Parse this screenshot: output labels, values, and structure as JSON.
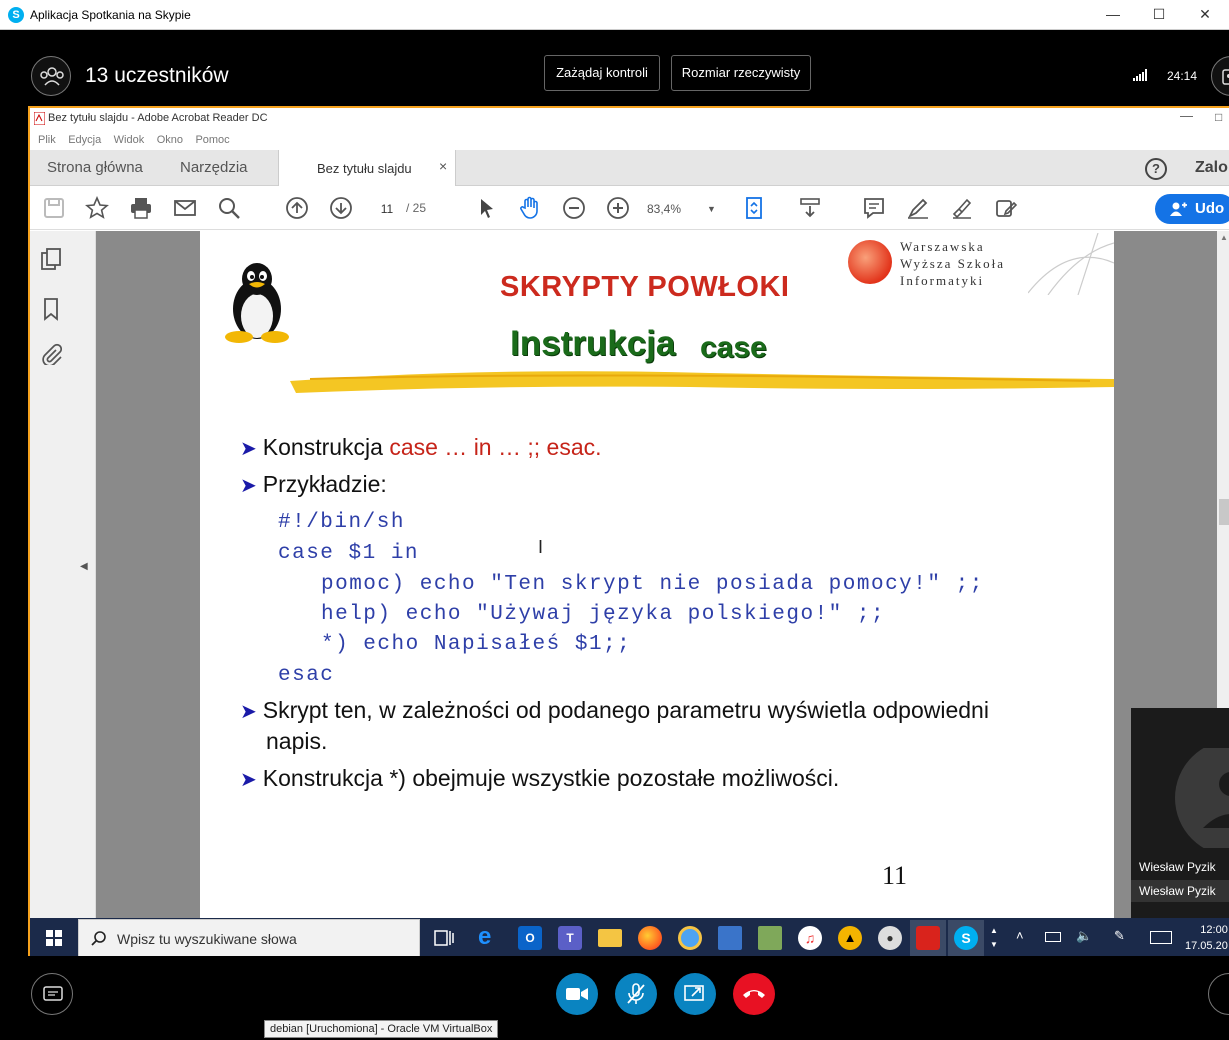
{
  "skype": {
    "window_title": "Aplikacja Spotkania na Skypie",
    "participants_label": "13 uczestników",
    "request_control_label": "Zażądaj kontroli",
    "actual_size_label": "Rozmiar rzeczywisty",
    "call_timer": "24:14"
  },
  "acrobat": {
    "window_title": "Bez tytułu slajdu - Adobe Acrobat Reader DC",
    "menu": [
      "Plik",
      "Edycja",
      "Widok",
      "Okno",
      "Pomoc"
    ],
    "tabs": {
      "home": "Strona główna",
      "tools": "Narzędzia",
      "document": "Bez tytułu slajdu"
    },
    "login_label": "Zalo",
    "page_current": "11",
    "page_total": "/ 25",
    "zoom": "83,4%",
    "share_label": "Udo"
  },
  "slide": {
    "title": "SKRYPTY POWŁOKI",
    "subtitle_main": "Instrukcja",
    "subtitle_code": "case",
    "university": [
      "Warszawska",
      "Wyższa Szkoła",
      "Informatyki"
    ],
    "bullet1_prefix": "Konstrukcja ",
    "bullet1_highlight": "case … in … ;; esac.",
    "bullet2": "Przykładzie:",
    "code_lines": [
      "#!/bin/sh",
      "case $1 in",
      "pomoc) echo \"Ten skrypt nie posiada pomocy!\" ;;",
      "help) echo \"Używaj języka polskiego!\" ;;",
      "*) echo Napisałeś $1;;",
      "esac"
    ],
    "bullet3_line1": "Skrypt ten, w zależności od podanego parametru wyświetla odpowiedni",
    "bullet3_line2": "napis.",
    "bullet4": "Konstrukcja *) obejmuje wszystkie pozostałe możliwości.",
    "page_number": "11"
  },
  "presenter": {
    "name_in_video": "Wiesław Pyzik",
    "name_label": "Wiesław Pyzik"
  },
  "taskbar": {
    "search_placeholder": "Wpisz tu wyszukiwane słowa",
    "time": "12:00",
    "date": "17.05.20"
  },
  "tooltip": "debian [Uruchomiona] - Oracle VM VirtualBox",
  "colors": {
    "accent_border": "#f6a21d",
    "slide_title": "#cc2a1e",
    "slide_subtitle": "#1a6b1a",
    "code": "#2e3fa8",
    "end_call": "#e81123",
    "call_button": "#0a84c1"
  }
}
